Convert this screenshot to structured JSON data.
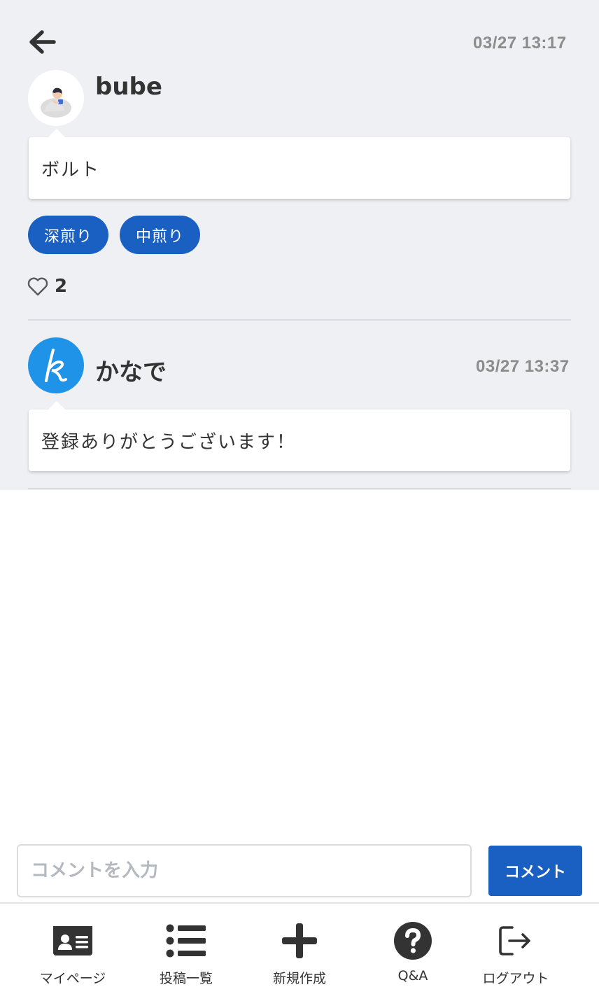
{
  "post": {
    "timestamp": "03/27 13:17",
    "author": "bube",
    "body": "ボルト",
    "tags": [
      "深煎り",
      "中煎り"
    ],
    "likes": "2"
  },
  "comment": {
    "author": "かなで",
    "timestamp": "03/27 13:37",
    "body": "登録ありがとうございます！"
  },
  "composer": {
    "placeholder": "コメントを入力",
    "submit_label": "コメント"
  },
  "nav": {
    "items": [
      {
        "label": "マイページ",
        "icon": "id-card-icon"
      },
      {
        "label": "投稿一覧",
        "icon": "list-icon"
      },
      {
        "label": "新規作成",
        "icon": "plus-icon"
      },
      {
        "label": "Q&A",
        "icon": "question-circle-icon"
      },
      {
        "label": "ログアウト",
        "icon": "logout-icon"
      }
    ]
  },
  "colors": {
    "accent": "#1a5fc2",
    "avatar_blue": "#1f93e8",
    "background": "#eef0f4"
  }
}
